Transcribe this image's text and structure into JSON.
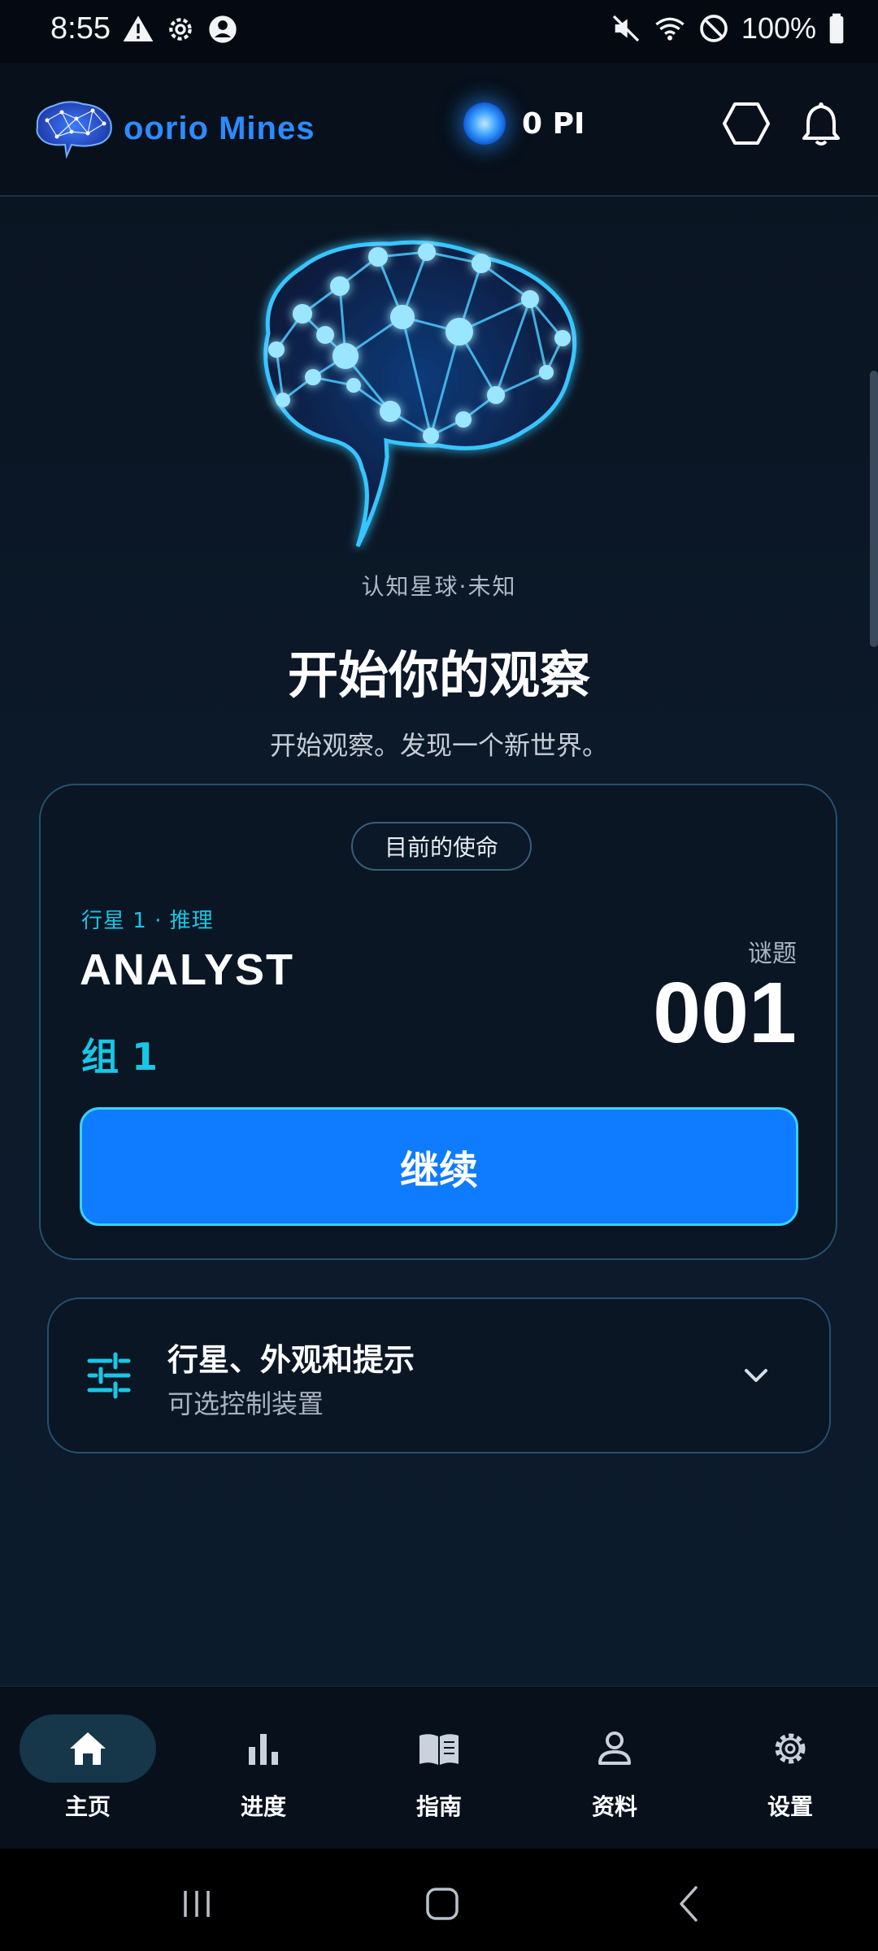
{
  "status_bar": {
    "time": "8:55",
    "battery": "100%",
    "left_icons": [
      "warning-icon",
      "settings-gear-icon",
      "account-circle-icon"
    ],
    "right_icons": [
      "mute-icon",
      "wifi-icon",
      "do-not-disturb-icon",
      "battery-icon"
    ]
  },
  "header": {
    "app_name": "oorio Mines",
    "balance": "0 PI",
    "icons": [
      "hexagon-icon",
      "bell-icon"
    ]
  },
  "hero": {
    "caption": "认知星球·未知",
    "title": "开始你的观察",
    "subtitle": "开始观察。发现一个新世界。"
  },
  "mission": {
    "badge": "目前的使命",
    "tag": "行星 1 · 推理",
    "name": "ANALYST",
    "group": "组 1",
    "puzzle_label": "谜题",
    "puzzle_number": "001",
    "continue_label": "继续"
  },
  "options": {
    "title": "行星、外观和提示",
    "subtitle": "可选控制装置"
  },
  "bottom_nav": {
    "items": [
      {
        "label": "主页",
        "icon": "home-icon",
        "active": true
      },
      {
        "label": "进度",
        "icon": "bar-chart-icon",
        "active": false
      },
      {
        "label": "指南",
        "icon": "book-icon",
        "active": false
      },
      {
        "label": "资料",
        "icon": "person-icon",
        "active": false
      },
      {
        "label": "设置",
        "icon": "settings-icon",
        "active": false
      }
    ]
  },
  "colors": {
    "accent": "#0f7bff",
    "cyan": "#19c6e6",
    "background": "#0a1320"
  }
}
